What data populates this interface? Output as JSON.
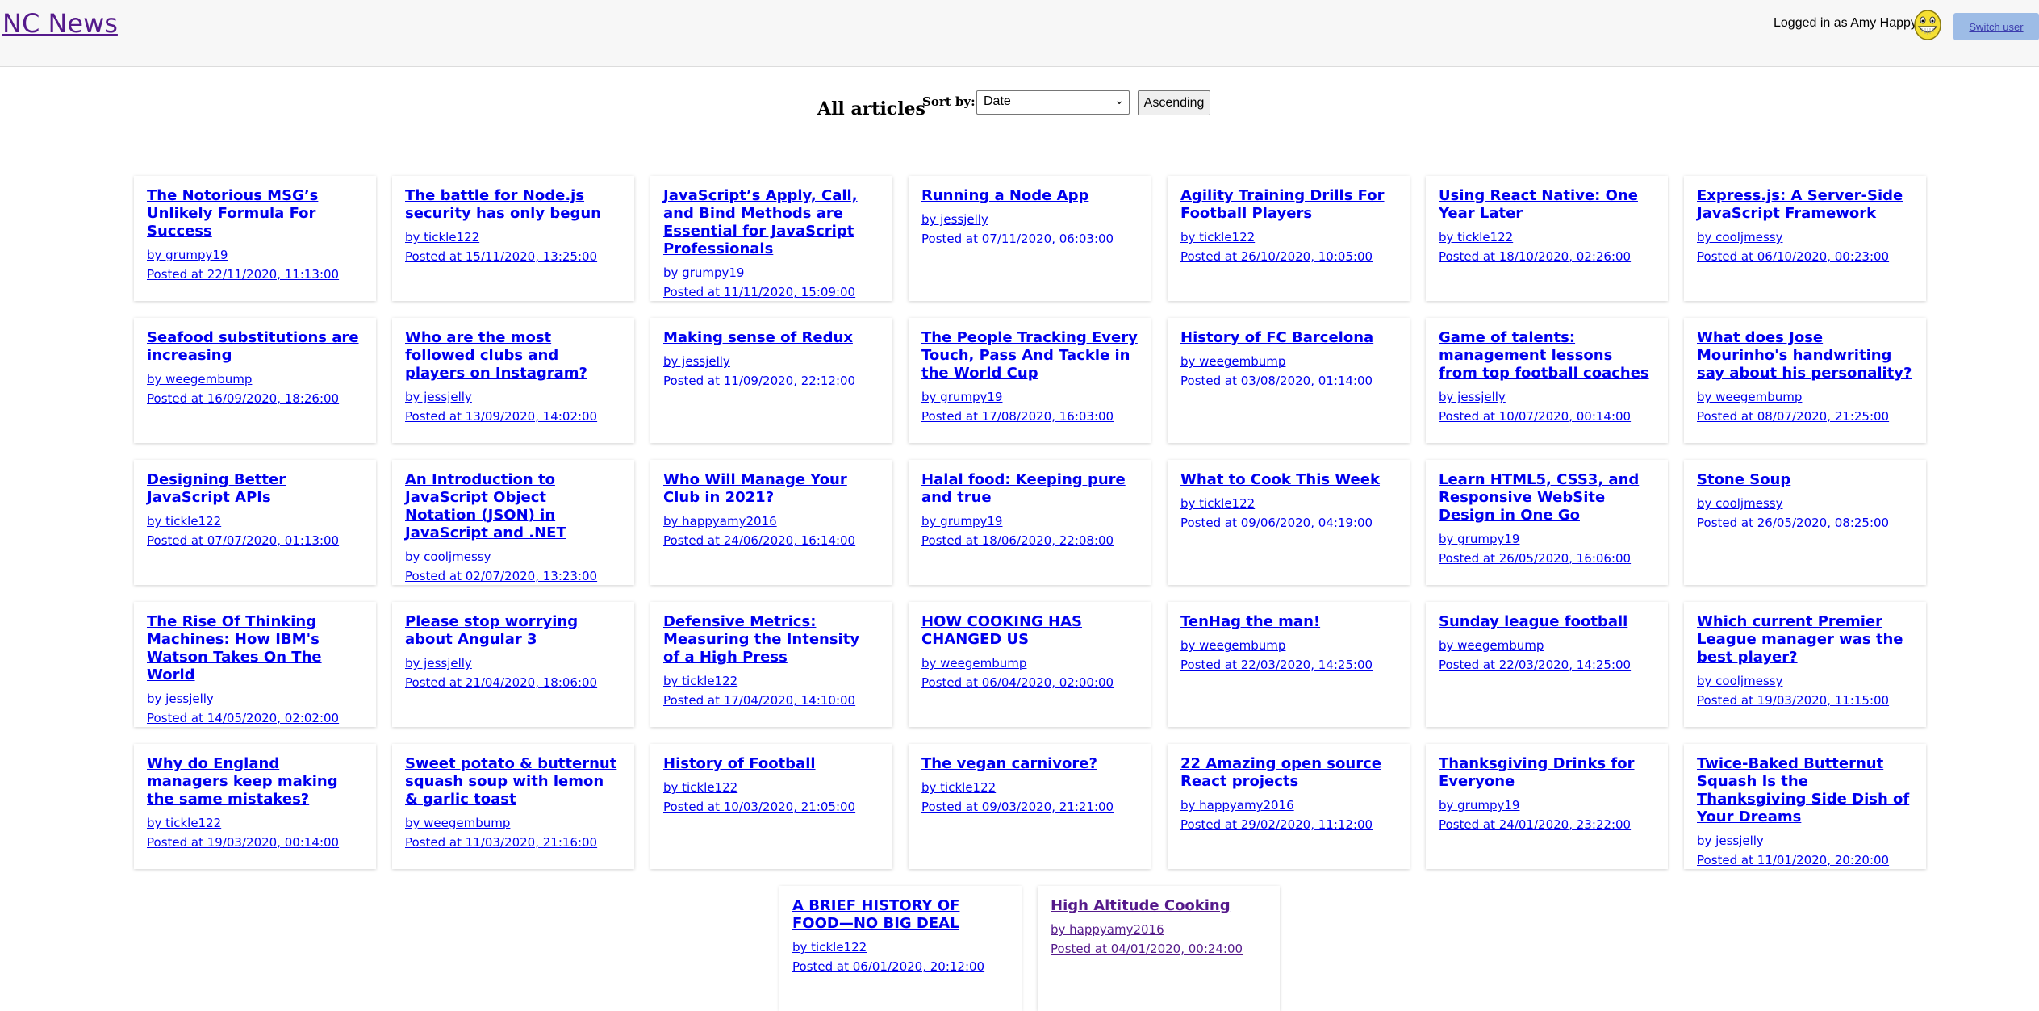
{
  "header": {
    "site_title": "NC News",
    "logged_in_text": "Logged in as Amy Happy",
    "avatar_icon": "smiley-avatar-icon",
    "switch_user_label": "Switch user"
  },
  "main": {
    "heading": "All articles",
    "sort_label": "Sort by:",
    "sort_selected": "Date",
    "order_label": "Ascending"
  },
  "articles": [
    {
      "title": "The Notorious MSG’s Unlikely Formula For Success",
      "author": "by grumpy19",
      "posted": "Posted at 22/11/2020, 11:13:00"
    },
    {
      "title": "The battle for Node.js security has only begun",
      "author": "by tickle122",
      "posted": "Posted at 15/11/2020, 13:25:00"
    },
    {
      "title": "JavaScript’s Apply, Call, and Bind Methods are Essential for JavaScript Professionals",
      "author": "by grumpy19",
      "posted": "Posted at 11/11/2020, 15:09:00"
    },
    {
      "title": "Running a Node App",
      "author": "by jessjelly",
      "posted": "Posted at 07/11/2020, 06:03:00"
    },
    {
      "title": "Agility Training Drills For Football Players",
      "author": "by tickle122",
      "posted": "Posted at 26/10/2020, 10:05:00"
    },
    {
      "title": "Using React Native: One Year Later",
      "author": "by tickle122",
      "posted": "Posted at 18/10/2020, 02:26:00"
    },
    {
      "title": "Express.js: A Server-Side JavaScript Framework",
      "author": "by cooljmessy",
      "posted": "Posted at 06/10/2020, 00:23:00"
    },
    {
      "title": "Seafood substitutions are increasing",
      "author": "by weegembump",
      "posted": "Posted at 16/09/2020, 18:26:00"
    },
    {
      "title": "Who are the most followed clubs and players on Instagram?",
      "author": "by jessjelly",
      "posted": "Posted at 13/09/2020, 14:02:00"
    },
    {
      "title": "Making sense of Redux",
      "author": "by jessjelly",
      "posted": "Posted at 11/09/2020, 22:12:00"
    },
    {
      "title": "The People Tracking Every Touch, Pass And Tackle in the World Cup",
      "author": "by grumpy19",
      "posted": "Posted at 17/08/2020, 16:03:00"
    },
    {
      "title": "History of FC Barcelona",
      "author": "by weegembump",
      "posted": "Posted at 03/08/2020, 01:14:00"
    },
    {
      "title": "Game of talents: management lessons from top football coaches",
      "author": "by jessjelly",
      "posted": "Posted at 10/07/2020, 00:14:00"
    },
    {
      "title": "What does Jose Mourinho's handwriting say about his personality?",
      "author": "by weegembump",
      "posted": "Posted at 08/07/2020, 21:25:00"
    },
    {
      "title": "Designing Better JavaScript APIs",
      "author": "by tickle122",
      "posted": "Posted at 07/07/2020, 01:13:00"
    },
    {
      "title": "An Introduction to JavaScript Object Notation (JSON) in JavaScript and .NET",
      "author": "by cooljmessy",
      "posted": "Posted at 02/07/2020, 13:23:00"
    },
    {
      "title": "Who Will Manage Your Club in 2021?",
      "author": "by happyamy2016",
      "posted": "Posted at 24/06/2020, 16:14:00"
    },
    {
      "title": "Halal food: Keeping pure and true",
      "author": "by grumpy19",
      "posted": "Posted at 18/06/2020, 22:08:00"
    },
    {
      "title": "What to Cook This Week",
      "author": "by tickle122",
      "posted": "Posted at 09/06/2020, 04:19:00"
    },
    {
      "title": "Learn HTML5, CSS3, and Responsive WebSite Design in One Go",
      "author": "by grumpy19",
      "posted": "Posted at 26/05/2020, 16:06:00"
    },
    {
      "title": "Stone Soup",
      "author": "by cooljmessy",
      "posted": "Posted at 26/05/2020, 08:25:00"
    },
    {
      "title": "The Rise Of Thinking Machines: How IBM's Watson Takes On The World",
      "author": "by jessjelly",
      "posted": "Posted at 14/05/2020, 02:02:00"
    },
    {
      "title": "Please stop worrying about Angular 3",
      "author": "by jessjelly",
      "posted": "Posted at 21/04/2020, 18:06:00"
    },
    {
      "title": "Defensive Metrics: Measuring the Intensity of a High Press",
      "author": "by tickle122",
      "posted": "Posted at 17/04/2020, 14:10:00"
    },
    {
      "title": "HOW COOKING HAS CHANGED US",
      "author": "by weegembump",
      "posted": "Posted at 06/04/2020, 02:00:00"
    },
    {
      "title": "TenHag the man!",
      "author": "by weegembump",
      "posted": "Posted at 22/03/2020, 14:25:00"
    },
    {
      "title": "Sunday league football",
      "author": "by weegembump",
      "posted": "Posted at 22/03/2020, 14:25:00"
    },
    {
      "title": "Which current Premier League manager was the best player?",
      "author": "by cooljmessy",
      "posted": "Posted at 19/03/2020, 11:15:00"
    },
    {
      "title": "Why do England managers keep making the same mistakes?",
      "author": "by tickle122",
      "posted": "Posted at 19/03/2020, 00:14:00"
    },
    {
      "title": "Sweet potato & butternut squash soup with lemon & garlic toast",
      "author": "by weegembump",
      "posted": "Posted at 11/03/2020, 21:16:00"
    },
    {
      "title": "History of Football",
      "author": "by tickle122",
      "posted": "Posted at 10/03/2020, 21:05:00"
    },
    {
      "title": "The vegan carnivore?",
      "author": "by tickle122",
      "posted": "Posted at 09/03/2020, 21:21:00"
    },
    {
      "title": "22 Amazing open source React projects",
      "author": "by happyamy2016",
      "posted": "Posted at 29/02/2020, 11:12:00"
    },
    {
      "title": "Thanksgiving Drinks for Everyone",
      "author": "by grumpy19",
      "posted": "Posted at 24/01/2020, 23:22:00"
    },
    {
      "title": "Twice-Baked Butternut Squash Is the Thanksgiving Side Dish of Your Dreams",
      "author": "by jessjelly",
      "posted": "Posted at 11/01/2020, 20:20:00"
    },
    {
      "title": "A BRIEF HISTORY OF FOOD—NO BIG DEAL",
      "author": "by tickle122",
      "posted": "Posted at 06/01/2020, 20:12:00"
    },
    {
      "title": "High Altitude Cooking",
      "author": "by happyamy2016",
      "posted": "Posted at 04/01/2020, 00:24:00",
      "visited": true
    }
  ]
}
